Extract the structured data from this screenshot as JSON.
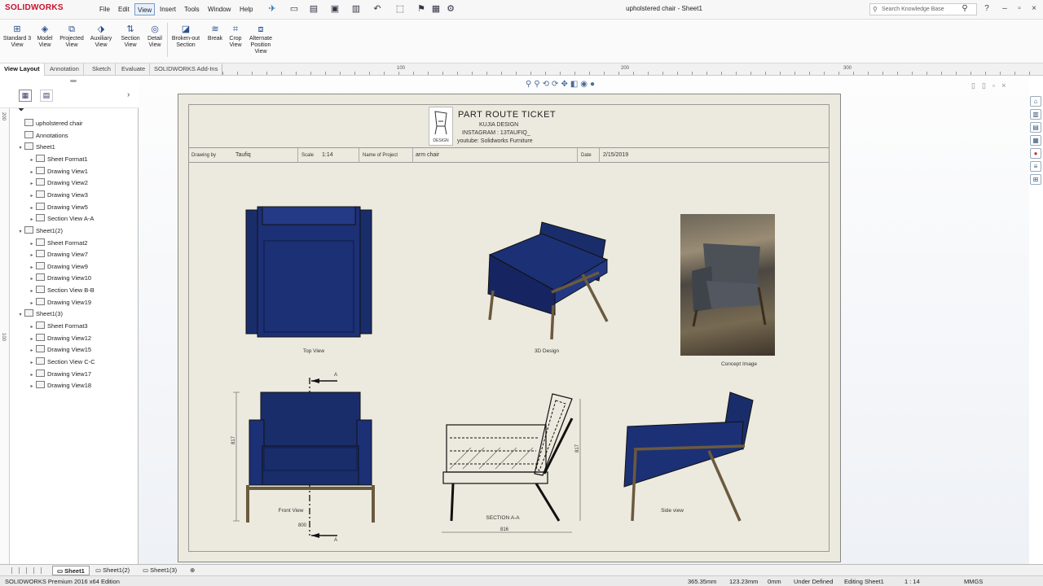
{
  "app": {
    "logo": "SOLIDWORKS",
    "document_title": "upholstered chair - Sheet1"
  },
  "menu": [
    "File",
    "Edit",
    "View",
    "Insert",
    "Tools",
    "Window",
    "Help"
  ],
  "search": {
    "placeholder": "Search Knowledge Base"
  },
  "ribbon": [
    {
      "label": "Standard 3 View",
      "icon": "standard-3-view-icon"
    },
    {
      "label": "Model View",
      "icon": "model-view-icon"
    },
    {
      "label": "Projected View",
      "icon": "projected-view-icon"
    },
    {
      "label": "Auxiliary View",
      "icon": "auxiliary-view-icon"
    },
    {
      "label": "Section View",
      "icon": "section-view-icon"
    },
    {
      "label": "Detail View",
      "icon": "detail-view-icon"
    },
    {
      "label": "Broken-out Section",
      "icon": "broken-out-section-icon"
    },
    {
      "label": "Break",
      "icon": "break-icon"
    },
    {
      "label": "Crop View",
      "icon": "crop-view-icon"
    },
    {
      "label": "Alternate Position View",
      "icon": "alternate-position-view-icon"
    }
  ],
  "command_tabs": [
    "View Layout",
    "Annotation",
    "Sketch",
    "Evaluate",
    "SOLIDWORKS Add-Ins"
  ],
  "ruler": {
    "ticks": [
      "100",
      "200",
      "300"
    ]
  },
  "vruler": {
    "ticks": [
      "200",
      "100"
    ]
  },
  "tree": [
    {
      "label": "upholstered chair",
      "level": 0,
      "toggle": ""
    },
    {
      "label": "Annotations",
      "level": 1,
      "toggle": ""
    },
    {
      "label": "Sheet1",
      "level": 1,
      "toggle": "▾"
    },
    {
      "label": "Sheet Format1",
      "level": 2,
      "toggle": "▸"
    },
    {
      "label": "Drawing View1",
      "level": 2,
      "toggle": "▸"
    },
    {
      "label": "Drawing View2",
      "level": 2,
      "toggle": "▸"
    },
    {
      "label": "Drawing View3",
      "level": 2,
      "toggle": "▸"
    },
    {
      "label": "Drawing View5",
      "level": 2,
      "toggle": "▸"
    },
    {
      "label": "Section View A-A",
      "level": 2,
      "toggle": "▸"
    },
    {
      "label": "Sheet1(2)",
      "level": 1,
      "toggle": "▾"
    },
    {
      "label": "Sheet Format2",
      "level": 2,
      "toggle": "▸"
    },
    {
      "label": "Drawing View7",
      "level": 2,
      "toggle": "▸"
    },
    {
      "label": "Drawing View9",
      "level": 2,
      "toggle": "▸"
    },
    {
      "label": "Drawing View10",
      "level": 2,
      "toggle": "▸"
    },
    {
      "label": "Section View B-B",
      "level": 2,
      "toggle": "▸"
    },
    {
      "label": "Drawing View19",
      "level": 2,
      "toggle": "▸"
    },
    {
      "label": "Sheet1(3)",
      "level": 1,
      "toggle": "▾"
    },
    {
      "label": "Sheet Format3",
      "level": 2,
      "toggle": "▸"
    },
    {
      "label": "Drawing View12",
      "level": 2,
      "toggle": "▸"
    },
    {
      "label": "Drawing View15",
      "level": 2,
      "toggle": "▸"
    },
    {
      "label": "Section View C-C",
      "level": 2,
      "toggle": "▸"
    },
    {
      "label": "Drawing View17",
      "level": 2,
      "toggle": "▸"
    },
    {
      "label": "Drawing View18",
      "level": 2,
      "toggle": "▸"
    }
  ],
  "drawing": {
    "title": "PART ROUTE TICKET",
    "line1": "KUJIA DESIGN",
    "line2": "INSTAGRAM : 13TAUFIQ_",
    "line3": "youtube: Solidworks Furniture",
    "logo_text": "DESIGN",
    "info": {
      "drawing_by_label": "Drawing by",
      "drawing_by": "Taufiq",
      "scale_label": "Scale",
      "scale": "1:14",
      "project_label": "Name of Project",
      "project": "arm chair",
      "date_label": "Date",
      "date": "2/15/2019"
    },
    "views": {
      "top": "Top View",
      "design3d": "3D Design",
      "concept": "Concept Image",
      "front": "Front View",
      "section": "SECTION A-A",
      "side": "Side view"
    },
    "dims": {
      "front_height": "817",
      "front_width": "800",
      "section_height": "817",
      "section_width": "816",
      "section_mark": "A"
    }
  },
  "sheet_tabs": [
    "Sheet1",
    "Sheet1(2)",
    "Sheet1(3)"
  ],
  "status": {
    "edition": "SOLIDWORKS Premium 2016 x64 Edition",
    "x": "365.35mm",
    "y": "123.23mm",
    "z": "0mm",
    "state": "Under Defined",
    "editing": "Editing Sheet1",
    "scale": "1 : 14",
    "units": "MMGS"
  }
}
